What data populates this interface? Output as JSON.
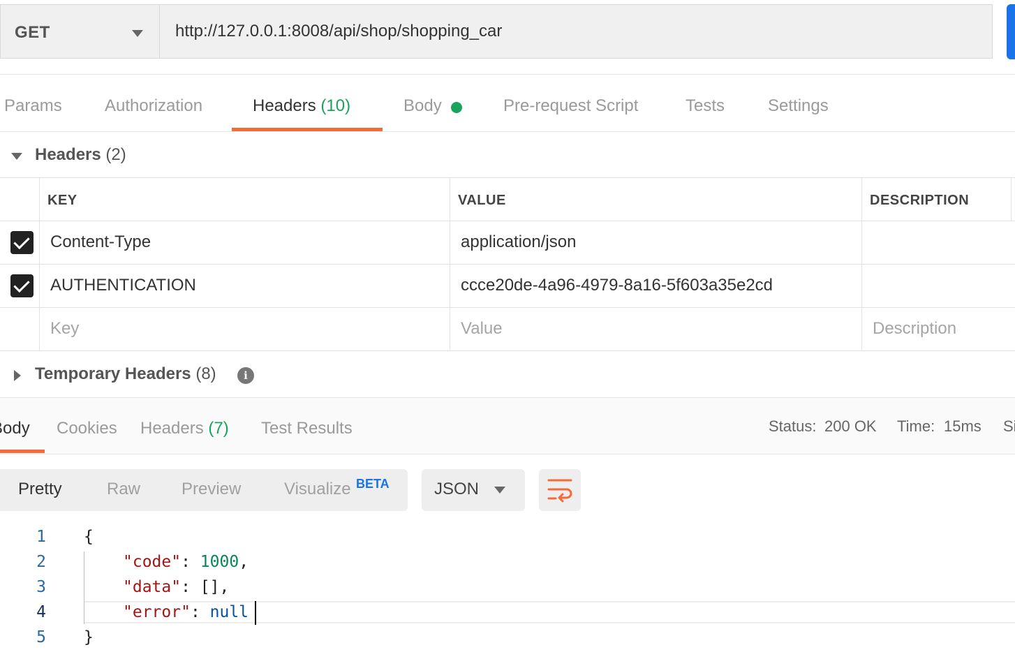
{
  "request": {
    "method": "GET",
    "url": "http://127.0.0.1:8008/api/shop/shopping_car"
  },
  "request_tabs": [
    {
      "label": "Params"
    },
    {
      "label": "Authorization"
    },
    {
      "label": "Headers",
      "count": "(10)"
    },
    {
      "label": "Body"
    },
    {
      "label": "Pre-request Script"
    },
    {
      "label": "Tests"
    },
    {
      "label": "Settings"
    }
  ],
  "headers_section": {
    "title": "Headers",
    "count": "(2)",
    "columns": {
      "key": "KEY",
      "value": "VALUE",
      "description": "DESCRIPTION"
    },
    "rows": [
      {
        "key": "Content-Type",
        "value": "application/json",
        "checked": true
      },
      {
        "key": "AUTHENTICATION",
        "value": "ccce20de-4a96-4979-8a16-5f603a35e2cd",
        "checked": true
      }
    ],
    "placeholders": {
      "key": "Key",
      "value": "Value",
      "description": "Description"
    }
  },
  "temporary_headers": {
    "title": "Temporary Headers",
    "count": "(8)",
    "info_glyph": "i"
  },
  "response_tabs": [
    {
      "label": "Body"
    },
    {
      "label": "Cookies"
    },
    {
      "label": "Headers",
      "count": "(7)"
    },
    {
      "label": "Test Results"
    }
  ],
  "response_status": {
    "status_label": "Status:",
    "status_value": "200 OK",
    "time_label": "Time:",
    "time_value": "15ms",
    "size_label_fragment": "Si"
  },
  "view_modes": [
    "Pretty",
    "Raw",
    "Preview",
    "Visualize"
  ],
  "visualize_badge": "BETA",
  "format": "JSON",
  "code": {
    "line_numbers": [
      "1",
      "2",
      "3",
      "4",
      "5"
    ],
    "open_brace": "{",
    "close_brace": "}",
    "code_key": "\"code\"",
    "code_value": "1000",
    "data_key": "\"data\"",
    "data_value": "[]",
    "error_key": "\"error\"",
    "error_value": "null"
  },
  "colors": {
    "accent_orange": "#f26b3a",
    "status_green": "#1aa35c",
    "send_blue": "#1a73e8"
  },
  "icons": [
    "method-dropdown-caret",
    "checkbox-checked-icon",
    "collapse-triangle-icon",
    "expand-triangle-icon",
    "info-icon",
    "wrap-lines-icon"
  ]
}
